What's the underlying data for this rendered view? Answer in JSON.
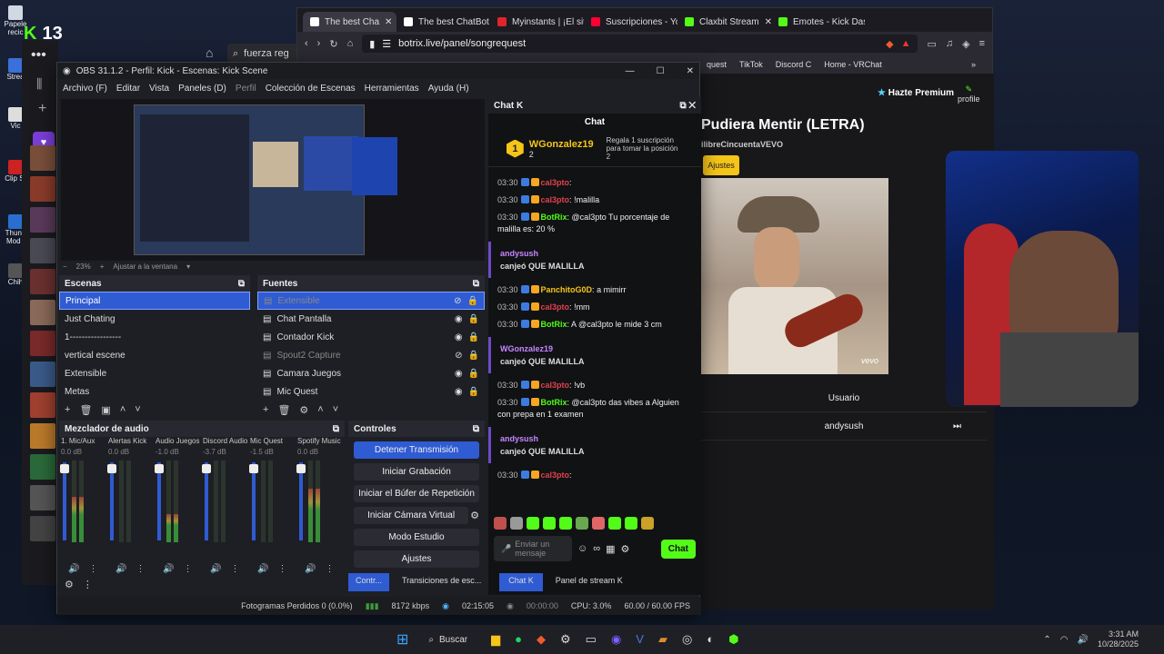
{
  "desktop": {
    "icons": [
      "Papele recic",
      "Strea",
      "Vic",
      "Clip St",
      "Thund Mod I",
      "Chih"
    ],
    "count_label": "13"
  },
  "explorer": {
    "search_text": "fuerza reg"
  },
  "browser": {
    "tabs": [
      {
        "label": "The best Cha",
        "color": "#ffffff",
        "active": true
      },
      {
        "label": "The best ChatBot an",
        "color": "#ffffff",
        "active": false
      },
      {
        "label": "Myinstants | ¡El sitio",
        "color": "#e0242b",
        "active": false
      },
      {
        "label": "Suscripciones - YouT",
        "color": "#ff0033",
        "active": false
      },
      {
        "label": "Claxbit Stream",
        "color": "#53fc18",
        "active": false
      },
      {
        "label": "Emotes - Kick Dashb",
        "color": "#53fc18",
        "active": false
      }
    ],
    "url": "botrix.live/panel/songrequest",
    "bookmarks": [
      "quest",
      "TikTok",
      "Discord C",
      "Home - VRChat"
    ],
    "song_title": "Pudiera Mentir (LETRA)",
    "channel": "ilibreCincuentaVEVO",
    "settings_button": "Ajustes",
    "premium": "Hazte Premium",
    "profile": "profile",
    "user_header": "Usuario",
    "user_name": "andysush",
    "watermark": "vevo"
  },
  "obs": {
    "title": "OBS 31.1.2 - Perfil: Kick - Escenas: Kick Scene",
    "menu": [
      "Archivo (F)",
      "Editar",
      "Vista",
      "Paneles (D)",
      "Perfil",
      "Colección de Escenas",
      "Herramientas",
      "Ayuda (H)"
    ],
    "zoom": "23%",
    "fit": "Ajustar a la ventana",
    "scenes_title": "Escenas",
    "scenes": [
      "Principal",
      "Just Chating",
      "1-----------------",
      "vertical escene",
      "Extensible",
      "Metas"
    ],
    "sources_title": "Fuentes",
    "sources": [
      {
        "name": "Extensible",
        "hidden": true
      },
      {
        "name": "Chat Pantalla",
        "hidden": false
      },
      {
        "name": "Contador Kick",
        "hidden": false
      },
      {
        "name": "Spout2 Capture",
        "hidden": true
      },
      {
        "name": "Camara Juegos",
        "hidden": false
      },
      {
        "name": "Mic Quest",
        "hidden": false
      }
    ],
    "mixer_title": "Mezclador de audio",
    "channels": [
      {
        "name": "1. Mic/Aux",
        "db": "0.0 dB",
        "level": 0.55
      },
      {
        "name": "Alertas Kick",
        "db": "0.0 dB",
        "level": 0.0
      },
      {
        "name": "Audio Juegos",
        "db": "-1.0 dB",
        "level": 0.35
      },
      {
        "name": "Discord Audio",
        "db": "-3.7 dB",
        "level": 0.0
      },
      {
        "name": "Mic Quest",
        "db": "-1.5 dB",
        "level": 0.0
      },
      {
        "name": "Spotify Music",
        "db": "0.0 dB",
        "level": 0.65
      }
    ],
    "controls_title": "Controles",
    "controls": [
      "Detener Transmisión",
      "Iniciar Grabación",
      "Iniciar el Búfer de Repetición",
      "Iniciar Cámara Virtual",
      "Modo Estudio",
      "Ajustes"
    ],
    "bottom_tabs": [
      "Contr...",
      "Transiciones de esc...",
      "Chat K",
      "Panel de stream K"
    ],
    "status": {
      "dropped": "Fotogramas Perdidos 0 (0.0%)",
      "bitrate": "8172 kbps",
      "live_time": "02:15:05",
      "rec_time": "00:00:00",
      "cpu": "CPU: 3.0%",
      "fps": "60.00 / 60.00 FPS"
    }
  },
  "chat": {
    "dock_title": "Chat K",
    "header": "Chat",
    "top_user": "WGonzalez19",
    "top_count": "2",
    "gift_text": "Regala 1 suscripción para tomar la posición 2",
    "messages": [
      {
        "time": "03:30",
        "user": "cal3pto",
        "cls": "u-red",
        "text": ""
      },
      {
        "time": "03:30",
        "user": "cal3pto",
        "cls": "u-red",
        "text": "!malilla"
      },
      {
        "time": "03:30",
        "user": "BotRix",
        "cls": "u-green",
        "text": "@cal3pto Tu porcentaje de malilla es: 20 %"
      },
      {
        "time": "03:30",
        "user": "PanchitoG0D",
        "cls": "u-yellow",
        "text": "a mimirr"
      },
      {
        "time": "03:30",
        "user": "cal3pto",
        "cls": "u-red",
        "text": "!mm"
      },
      {
        "time": "03:30",
        "user": "BotRix",
        "cls": "u-green",
        "text": "A @cal3pto le mide 3 cm"
      },
      {
        "time": "03:30",
        "user": "cal3pto",
        "cls": "u-red",
        "text": "!vb"
      },
      {
        "time": "03:30",
        "user": "BotRix",
        "cls": "u-green",
        "text": "@cal3pto das vibes a Alguien con prepa en 1 examen"
      },
      {
        "time": "03:30",
        "user": "cal3pto",
        "cls": "u-red",
        "text": ""
      }
    ],
    "subs": [
      {
        "user": "andysush",
        "text": "canjeó QUE MALILLA"
      },
      {
        "user": "WGonzalez19",
        "text": "canjeó QUE MALILLA"
      },
      {
        "user": "andysush",
        "text": "canjeó QUE MALILLA"
      }
    ],
    "input_placeholder": "Enviar un mensaje",
    "send": "Chat"
  },
  "taskbar": {
    "search": "Buscar",
    "time": "3:31 AM",
    "date": "10/28/2025"
  }
}
